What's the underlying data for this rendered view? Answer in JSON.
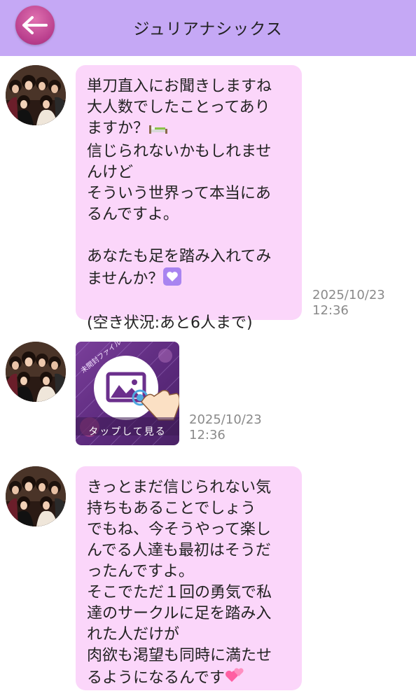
{
  "header": {
    "title": "ジュリアナシックス",
    "back_icon": "left-arrow-icon",
    "background_color": "#c5a8f5"
  },
  "messages": [
    {
      "type": "text",
      "avatar_icon": "avatar-group-photo",
      "lines": [
        "単刀直入にお聞きしますね",
        "大人数でしたことってあり",
        "ますか？",
        "信じられないかもしれませ",
        "んけど",
        "そういう世界って本当にあ",
        "るんですよ。",
        "",
        "あなたも足を踏み入れてみ",
        "ませんか？",
        "",
        "(空き状況:あと6人まで)"
      ],
      "timestamp_date": "2025/10/23",
      "timestamp_time": "12:36"
    },
    {
      "type": "image",
      "avatar_icon": "avatar-group-photo",
      "image_caption": "タップして見る",
      "image_tag": "未開封ファイル",
      "timestamp_date": "2025/10/23",
      "timestamp_time": "12:36"
    },
    {
      "type": "text",
      "avatar_icon": "avatar-group-photo",
      "lines": [
        "きっとまだ信じられない気",
        "持ちもあることでしょう",
        "でもね、今そうやって楽し",
        "んでる人達も最初はそうだ",
        "ったんですよ。",
        "そこでただ１回の勇気で私",
        "達のサークルに足を踏み入",
        "れた人だけが",
        "肉欲も渇望も同時に満たせ",
        "るようになるんです"
      ]
    }
  ],
  "colors": {
    "bubble": "#fbd6fa",
    "timestamp": "#8a8a8a",
    "back_button": "#b83d8c"
  }
}
